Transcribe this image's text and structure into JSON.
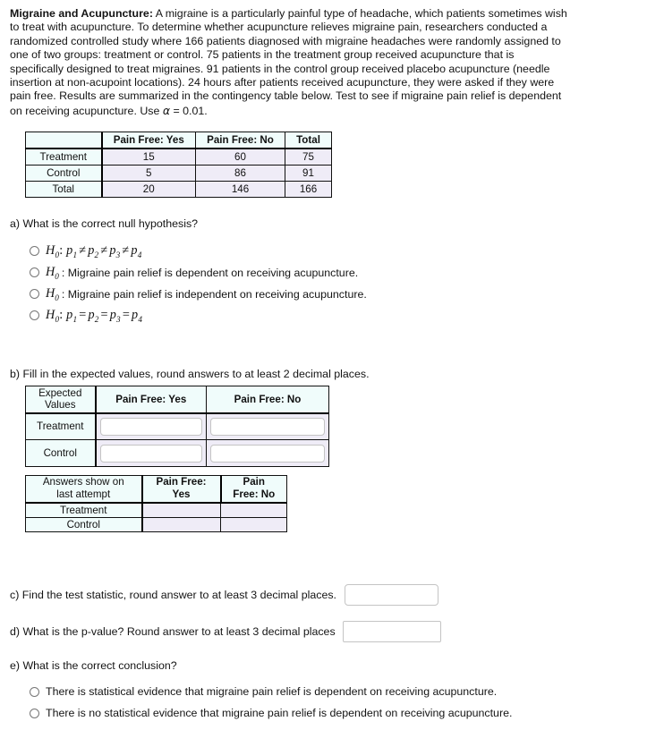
{
  "prompt": {
    "title": "Migraine and Acupuncture:",
    "body": " A migraine is a particularly painful type of headache, which patients sometimes wish to treat with acupuncture. To determine whether acupuncture relieves migraine pain, researchers conducted a randomized controlled study where 166 patients diagnosed with migraine headaches were randomly assigned to one of two groups: treatment or control. 75 patients in the treatment group received acupuncture that is specifically designed to treat migraines. 91 patients in the control group received placebo acupuncture (needle insertion at non-acupoint locations). 24 hours after patients received acupuncture, they were asked if they were pain free. Results are summarized in the contingency table below. Test to see if migraine pain relief is dependent on receiving acupuncture. Use ",
    "alpha_clause": " = 0.01.",
    "alpha_symbol": "α"
  },
  "contingency_table": {
    "corner": "",
    "columns": [
      "Pain Free: Yes",
      "Pain Free: No",
      "Total"
    ],
    "rows": [
      {
        "label": "Treatment",
        "values": [
          "15",
          "60",
          "75"
        ]
      },
      {
        "label": "Control",
        "values": [
          "5",
          "86",
          "91"
        ]
      },
      {
        "label": "Total",
        "values": [
          "20",
          "146",
          "166"
        ]
      }
    ]
  },
  "part_a": {
    "question": "a) What is the correct null hypothesis?",
    "options": [
      {
        "type": "math",
        "h": "H",
        "sub": "0",
        "p1": "p",
        "s1": "1",
        "op1": "≠",
        "p2": "p",
        "s2": "2",
        "op2": "≠",
        "p3": "p",
        "s3": "3",
        "op3": "≠",
        "p4": "p",
        "s4": "4"
      },
      {
        "type": "text",
        "h": "H",
        "sub": "0",
        "text": ": Migraine pain relief is dependent on receiving acupuncture."
      },
      {
        "type": "text",
        "h": "H",
        "sub": "0",
        "text": ": Migraine pain relief is independent on receiving acupuncture."
      },
      {
        "type": "math",
        "h": "H",
        "sub": "0",
        "p1": "p",
        "s1": "1",
        "op1": "=",
        "p2": "p",
        "s2": "2",
        "op2": "=",
        "p3": "p",
        "s3": "3",
        "op3": "=",
        "p4": "p",
        "s4": "4"
      }
    ]
  },
  "part_b": {
    "question": "b) Fill in the expected values, round answers to at least 2 decimal places.",
    "expected_table": {
      "corner_line1": "Expected",
      "corner_line2": "Values",
      "columns": [
        "Pain Free: Yes",
        "Pain Free: No"
      ],
      "rows": [
        {
          "label": "Treatment",
          "inputs": [
            "",
            ""
          ],
          "placeholders": [
            "",
            ""
          ]
        },
        {
          "label": "Control",
          "inputs": [
            "",
            ""
          ],
          "placeholders": [
            "",
            ""
          ]
        }
      ]
    },
    "last_attempt_table": {
      "corner_line1": "Answers show on",
      "corner_line2": "last attempt",
      "col1_line1": "Pain Free:",
      "col1_line2": "Yes",
      "col2_line1": "Pain",
      "col2_line2": "Free: No",
      "rows": [
        {
          "label": "Treatment",
          "values": [
            "",
            ""
          ]
        },
        {
          "label": "Control",
          "values": [
            "",
            ""
          ]
        }
      ]
    }
  },
  "part_c": {
    "question": "c) Find the test statistic, round answer to at least 3 decimal places.",
    "value": "",
    "placeholder": ""
  },
  "part_d": {
    "question": "d) What is the p-value? Round answer to at least 3 decimal places",
    "value": "",
    "placeholder": ""
  },
  "part_e": {
    "question": "e) What is the correct conclusion?",
    "options": [
      "There is statistical evidence that migraine pain relief is dependent on receiving acupuncture.",
      "There is no statistical evidence that migraine pain relief is dependent on receiving acupuncture."
    ]
  },
  "colors": {
    "header_cell": "#f0fcfb",
    "data_cell": "#efecf7",
    "border": "#111111",
    "input_border": "#c4c4c4",
    "text": "#141414"
  }
}
